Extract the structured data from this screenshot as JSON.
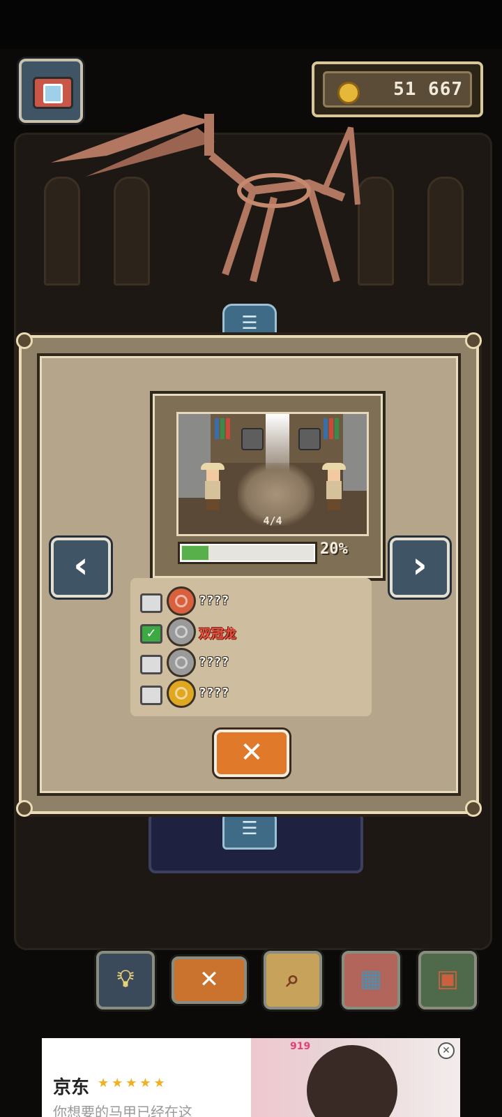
{
  "header": {
    "camera_icon": "camera-icon",
    "coins": "51 667",
    "coin_icon": "coin-icon"
  },
  "dialog": {
    "preview_count": "4/4",
    "progress_percent": "20%",
    "progress_value": 0.2,
    "prev_label": "‹",
    "next_label": "›",
    "species": [
      {
        "name": "????",
        "checked": false,
        "icon_color": "#d9603e"
      },
      {
        "name": "双冠龙",
        "checked": true,
        "icon_color": "#9a9a9a"
      },
      {
        "name": "????",
        "checked": false,
        "icon_color": "#9a9a9a"
      },
      {
        "name": "????",
        "checked": false,
        "icon_color": "#e0a820"
      }
    ],
    "close_label": "✕"
  },
  "toolbar": {
    "hint_icon": "lightbulb-icon",
    "cancel_label": "✕",
    "inspect_icon": "magnifier-question-icon",
    "map_icon": "map-icon",
    "book_icon": "fossil-book-icon"
  },
  "ad": {
    "brand": "京东",
    "stars": "★★★★★",
    "tagline": "你想要的马甲已经在这",
    "badge": "919",
    "close_icon": "close-circle-icon"
  },
  "colors": {
    "dialog_bg": "#b5a58b",
    "accent_orange": "#e07a2a",
    "nav_blue": "#3f5464",
    "progress_green": "#57b04a"
  }
}
